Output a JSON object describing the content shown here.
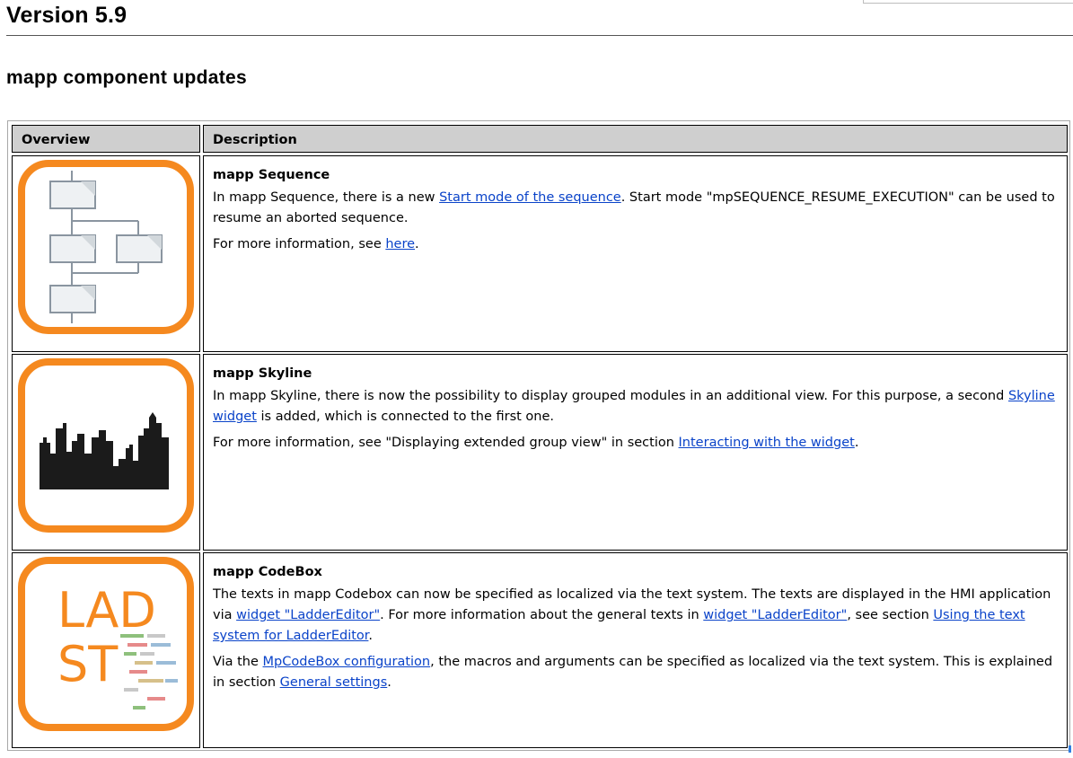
{
  "page": {
    "version_title": "Version 5.9",
    "section_title": "mapp component updates"
  },
  "table": {
    "headers": {
      "overview": "Overview",
      "description": "Description"
    },
    "rows": [
      {
        "icon": "sequence-flowchart-icon",
        "title": "mapp Sequence",
        "p1_a": "In mapp Sequence, there is a new ",
        "p1_link": "Start mode of the sequence",
        "p1_b": ". Start mode \"mpSEQUENCE_RESUME_EXECUTION\" can be used to resume an aborted sequence.",
        "p2_a": "For more information, see ",
        "p2_link": "here",
        "p2_b": "."
      },
      {
        "icon": "skyline-icon",
        "title": "mapp Skyline",
        "p1_a": "In mapp Skyline, there is now the possibility to display grouped modules in an additional view. For this purpose, a second ",
        "p1_link": "Skyline widget",
        "p1_b": " is added, which is connected to the first one.",
        "p2_a": "For more information, see \"Displaying extended group view\" in section ",
        "p2_link": "Interacting with the widget",
        "p2_b": "."
      },
      {
        "icon": "ladder-st-code-icon",
        "icon_text_1": "LAD",
        "icon_text_2": "ST",
        "title": "mapp CodeBox",
        "p1_a": "The texts in mapp Codebox can now be specified as localized via the text system. The texts are displayed in the HMI application via ",
        "p1_link": "widget \"LadderEditor\"",
        "p1_b": ". For more information about the general texts in ",
        "p1_link2": "widget \"LadderEditor\"",
        "p1_c": ", see section ",
        "p1_link3": "Using the text system for LadderEditor",
        "p1_d": ".",
        "p2_a": "Via the ",
        "p2_link": "MpCodeBox configuration",
        "p2_b": ", the macros and arguments can be specified as localized via the text system. This is explained in section ",
        "p2_link2": "General settings",
        "p2_c": "."
      }
    ]
  },
  "colors": {
    "accent_orange": "#F5891F",
    "link_blue": "#0a43c9",
    "header_gray": "#cfcfcf"
  }
}
